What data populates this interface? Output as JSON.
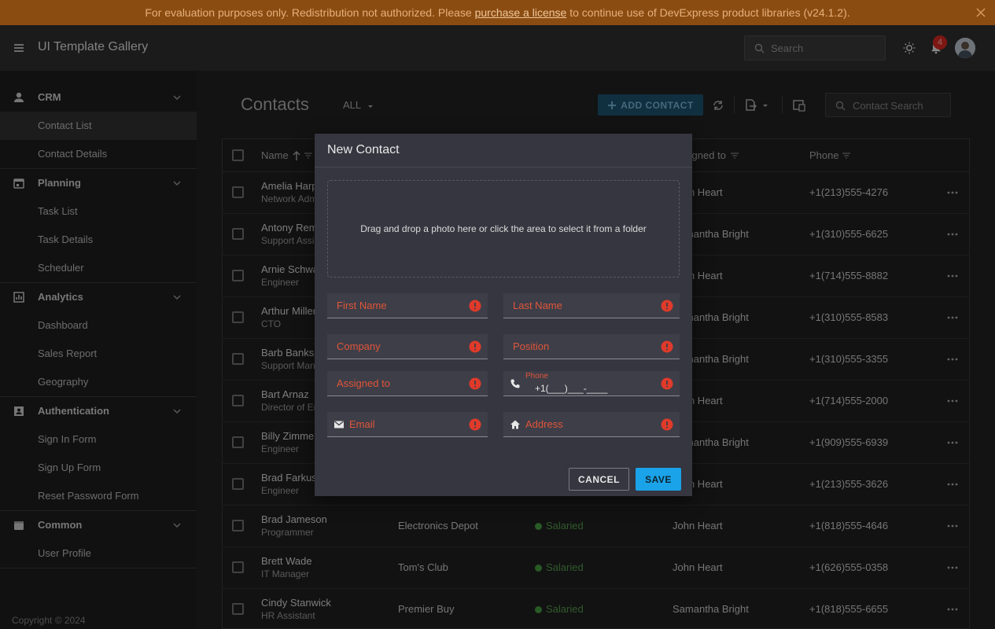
{
  "banner": {
    "text_before": "For evaluation purposes only. Redistribution not authorized. Please ",
    "link": "purchase a license",
    "text_after": " to continue use of DevExpress product libraries (v24.1.2)."
  },
  "header": {
    "app_title": "UI Template Gallery",
    "search_placeholder": "Search",
    "notification_count": "4"
  },
  "sidebar": {
    "groups": [
      {
        "label": "CRM",
        "items": [
          "Contact List",
          "Contact Details"
        ]
      },
      {
        "label": "Planning",
        "items": [
          "Task List",
          "Task Details",
          "Scheduler"
        ]
      },
      {
        "label": "Analytics",
        "items": [
          "Dashboard",
          "Sales Report",
          "Geography"
        ]
      },
      {
        "label": "Authentication",
        "items": [
          "Sign In Form",
          "Sign Up Form",
          "Reset Password Form"
        ]
      },
      {
        "label": "Common",
        "items": [
          "User Profile"
        ]
      }
    ],
    "active_item": "Contact List",
    "copyright": "Copyright © 2024"
  },
  "main": {
    "title": "Contacts",
    "filter": "ALL",
    "add_button": "ADD CONTACT",
    "search_placeholder": "Contact Search",
    "columns": [
      "Name",
      "Assigned to",
      "Phone"
    ],
    "rows": [
      {
        "name": "Amelia Harper",
        "position": "Network Admin",
        "company": "",
        "status": "",
        "assigned": "John Heart",
        "phone": "+1(213)555-4276"
      },
      {
        "name": "Antony Remmen",
        "position": "Support Assistant",
        "company": "",
        "status": "",
        "assigned": "Samantha Bright",
        "phone": "+1(310)555-6625"
      },
      {
        "name": "Arnie Schwartz",
        "position": "Engineer",
        "company": "",
        "status": "",
        "assigned": "John Heart",
        "phone": "+1(714)555-8882"
      },
      {
        "name": "Arthur Miller",
        "position": "CTO",
        "company": "",
        "status": "",
        "assigned": "Samantha Bright",
        "phone": "+1(310)555-8583"
      },
      {
        "name": "Barb Banks",
        "position": "Support Manager",
        "company": "",
        "status": "",
        "assigned": "Samantha Bright",
        "phone": "+1(310)555-3355"
      },
      {
        "name": "Bart Arnaz",
        "position": "Director of Engineering",
        "company": "",
        "status": "",
        "assigned": "John Heart",
        "phone": "+1(714)555-2000"
      },
      {
        "name": "Billy Zimmer",
        "position": "Engineer",
        "company": "",
        "status": "",
        "assigned": "Samantha Bright",
        "phone": "+1(909)555-6939"
      },
      {
        "name": "Brad Farkus",
        "position": "Engineer",
        "company": "",
        "status": "",
        "assigned": "John Heart",
        "phone": "+1(213)555-3626"
      },
      {
        "name": "Brad Jameson",
        "position": "Programmer",
        "company": "Electronics Depot",
        "status": "Salaried",
        "assigned": "John Heart",
        "phone": "+1(818)555-4646"
      },
      {
        "name": "Brett Wade",
        "position": "IT Manager",
        "company": "Tom's Club",
        "status": "Salaried",
        "assigned": "John Heart",
        "phone": "+1(626)555-0358"
      },
      {
        "name": "Cindy Stanwick",
        "position": "HR Assistant",
        "company": "Premier Buy",
        "status": "Salaried",
        "assigned": "Samantha Bright",
        "phone": "+1(818)555-6655"
      }
    ]
  },
  "dialog": {
    "title": "New Contact",
    "dropzone_text": "Drag and drop a photo here or click the area to select it from a folder",
    "fields": {
      "first_name": "First Name",
      "last_name": "Last Name",
      "company": "Company",
      "position": "Position",
      "assigned_to": "Assigned to",
      "phone_label": "Phone",
      "phone_value": "+1(___)___-____",
      "email": "Email",
      "address": "Address"
    },
    "cancel": "CANCEL",
    "save": "SAVE"
  },
  "colors": {
    "accent": "#1aa3e8",
    "error": "#e0553a",
    "banner": "#8b4c12",
    "status_salaried": "#3e8a3a"
  },
  "icons": [
    "close-icon",
    "hamburger-icon",
    "search-icon",
    "sun-icon",
    "bell-icon",
    "person-icon",
    "calendar-icon",
    "chart-icon",
    "id-card-icon",
    "folder-icon",
    "chevron-down-icon",
    "refresh-icon",
    "export-icon",
    "column-chooser-icon",
    "more-icon",
    "error-icon",
    "phone-icon",
    "email-icon",
    "home-icon",
    "sort-up-icon",
    "filter-icon"
  ]
}
